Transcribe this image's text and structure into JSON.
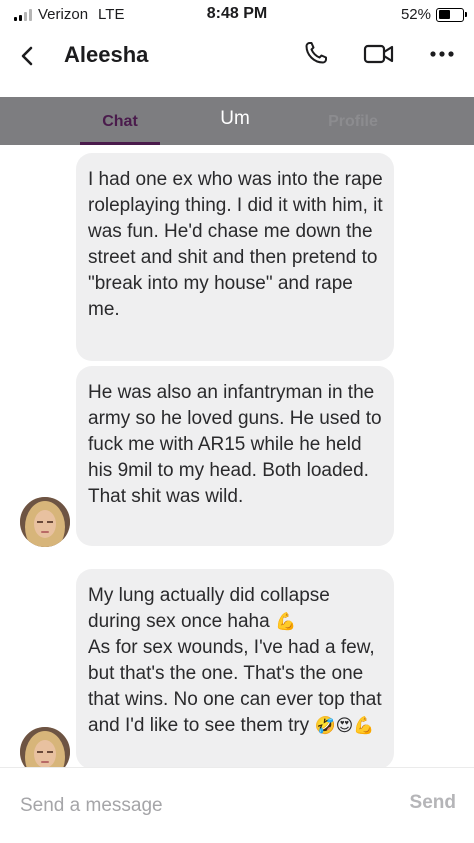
{
  "status_bar": {
    "carrier": "Verizon",
    "network": "LTE",
    "time": "8:48 PM",
    "battery_percent": "52%",
    "battery_level": 0.52
  },
  "header": {
    "title": "Aleesha",
    "icons": [
      "chevron-left-icon",
      "phone-icon",
      "video-camera-icon",
      "more-icon"
    ]
  },
  "tabs": [
    {
      "label": "Chat",
      "active": true
    },
    {
      "label": "Um",
      "active": false
    },
    {
      "label": "Profile",
      "active": false
    }
  ],
  "messages": [
    {
      "text": "I had one ex who was into the rape roleplaying thing. I did it with him, it was fun. He'd chase me down the street and shit and then pretend to \"break into my house\" and rape me."
    },
    {
      "text": "He was also an infantryman in the army so he loved guns. He used to fuck me with AR15 while he held his 9mil to my head. Both loaded. That shit was wild."
    },
    {
      "line1": "My lung actually did collapse during sex once haha",
      "emoji1": "💪",
      "line2": "As for sex wounds, I've had a few, but that's the one. That's the one that wins. No one can ever top that and I'd like to see them try",
      "emoji2": "🤣😍💪"
    }
  ],
  "composer": {
    "placeholder": "Send a message",
    "send_label": "Send"
  },
  "colors": {
    "tab_bar": "#7d7d80",
    "active_tab": "#4a1b4c",
    "bubble": "#efeff0",
    "send_disabled": "#b5b5b8"
  }
}
